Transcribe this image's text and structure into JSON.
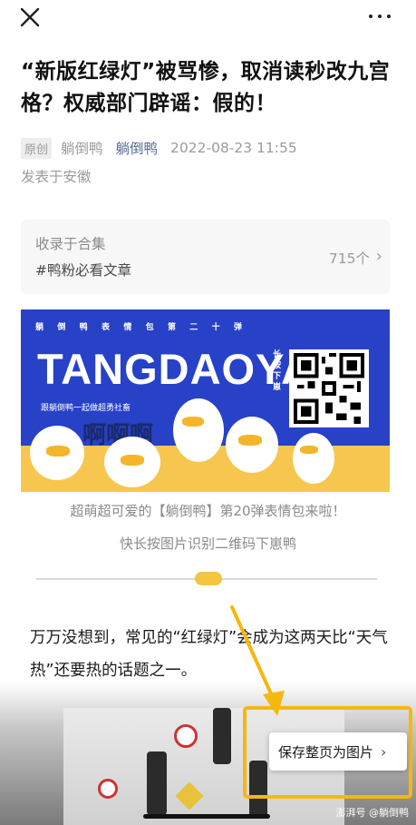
{
  "header": {
    "close_icon": "close-icon",
    "more_icon": "more-icon"
  },
  "article": {
    "title": "“新版红绿灯”被骂惨，取消读秒改九宫格？权威部门辟谣：假的！",
    "badge": "原创",
    "author": "躺倒鸭",
    "account": "躺倒鸭",
    "datetime": "2022-08-23 11:55",
    "location": "发表于安徽"
  },
  "collection": {
    "label": "收录于合集",
    "tag": "#鸭粉必看文章",
    "count": "715个"
  },
  "banner": {
    "top_text": [
      "躺",
      "倒",
      "鸭",
      "表",
      "情",
      "包",
      "第",
      "二",
      "十",
      "弹"
    ],
    "brand": "TANGDAOYA",
    "subtitle": "跟躺倒鸭一起做超勇社畜",
    "shout": "啊啊啊",
    "qr_label": "长按下崽"
  },
  "captions": {
    "line1": "超萌超可爱的【躺倒鸭】第20弹表情包来啦！",
    "line2": "快长按图片识别二维码下崽鸭"
  },
  "body": {
    "paragraph": "万万没想到，常见的“红绿灯”会成为这两天比“天气热”还要热的话题之一。"
  },
  "save_button": {
    "label": "保存整页为图片",
    "chevron": "›"
  },
  "watermark": "澎湃号 @躺倒鸭",
  "colors": {
    "link": "#576b95",
    "highlight": "#f5b80c",
    "banner_blue": "#2741c7",
    "banner_yellow": "#f6c64f"
  }
}
